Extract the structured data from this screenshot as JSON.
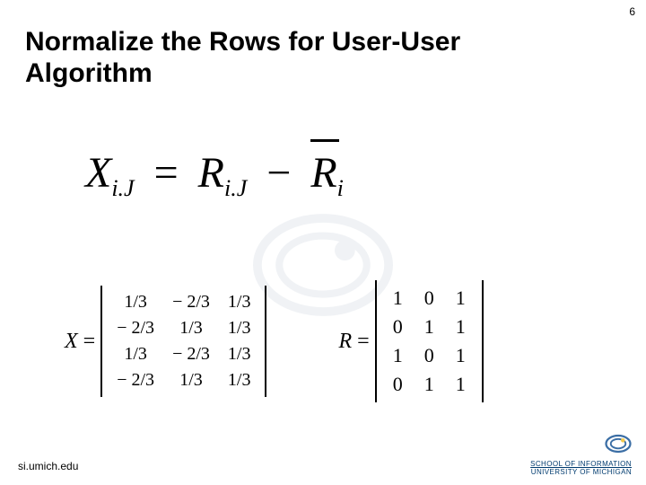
{
  "page_number": "6",
  "title_l1": "Normalize the Rows for User-User",
  "title_l2": "Algorithm",
  "equation": {
    "lhs_var": "X",
    "lhs_sub": "i.J",
    "eq": "=",
    "term1_var": "R",
    "term1_sub": "i.J",
    "minus": "−",
    "term2_var": "R",
    "term2_sub": "i"
  },
  "matX": {
    "label": "X",
    "eq": "=",
    "rows": [
      [
        "1/3",
        "− 2/3",
        "1/3"
      ],
      [
        "− 2/3",
        "1/3",
        "1/3"
      ],
      [
        "1/3",
        "− 2/3",
        "1/3"
      ],
      [
        "− 2/3",
        "1/3",
        "1/3"
      ]
    ]
  },
  "matR": {
    "label": "R",
    "eq": "=",
    "rows": [
      [
        "1",
        "0",
        "1"
      ],
      [
        "0",
        "1",
        "1"
      ],
      [
        "1",
        "0",
        "1"
      ],
      [
        "0",
        "1",
        "1"
      ]
    ]
  },
  "footer": {
    "url": "si.umich.edu",
    "l1": "SCHOOL OF INFORMATION",
    "l2": "UNIVERSITY OF MICHIGAN"
  }
}
